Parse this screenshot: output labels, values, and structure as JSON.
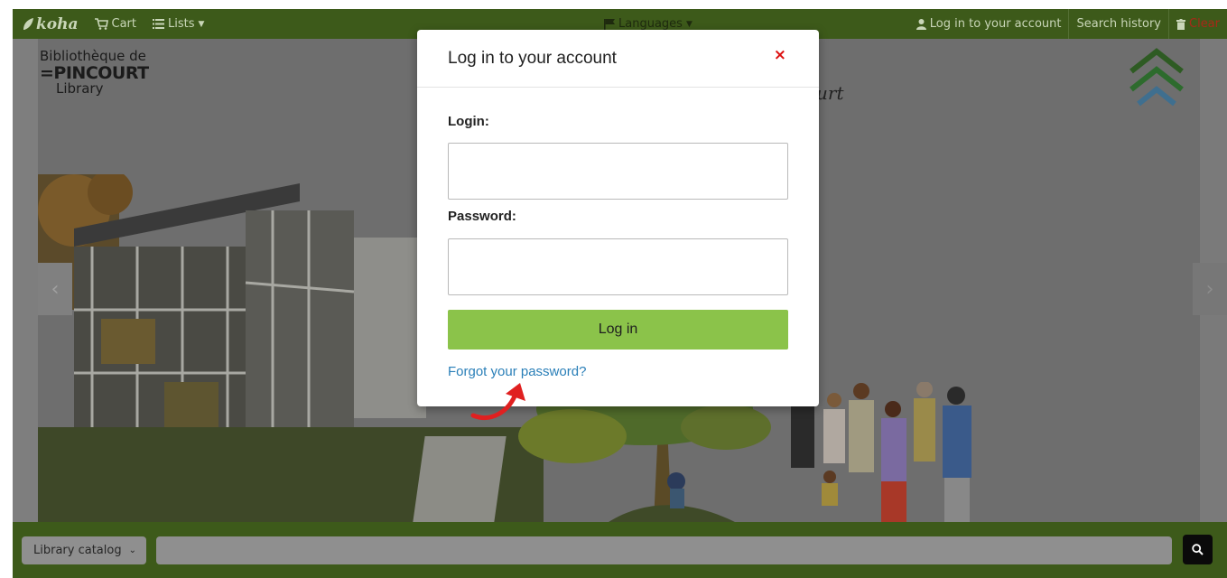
{
  "navbar": {
    "logo": "koha",
    "cart": "Cart",
    "lists": "Lists",
    "languages": "Languages",
    "login": "Log in to your account",
    "search_history": "Search history",
    "clear": "Clear"
  },
  "banner": {
    "brand_line1": "Bibliothèque de",
    "brand_line2": "=PINCOURT",
    "brand_line3": "Library",
    "script_text": "urt",
    "prev_arrow": "‹",
    "next_arrow": "›"
  },
  "modal": {
    "title": "Log in to your account",
    "close": "×",
    "login_label": "Login:",
    "login_value": "",
    "password_label": "Password:",
    "password_value": "",
    "submit": "Log in",
    "forgot": "Forgot your password?"
  },
  "search": {
    "scope_selected": "Library catalog",
    "query": ""
  },
  "colors": {
    "navbar": "#3d5a1a",
    "login_button": "#8bc34a",
    "link": "#2a7fb8",
    "close": "#dd1111"
  },
  "icons": [
    "koha-leaf-icon",
    "cart-icon",
    "list-icon",
    "flag-icon",
    "user-icon",
    "trash-icon",
    "close-icon",
    "search-icon",
    "chevron-up-icon",
    "red-arrow-icon"
  ]
}
